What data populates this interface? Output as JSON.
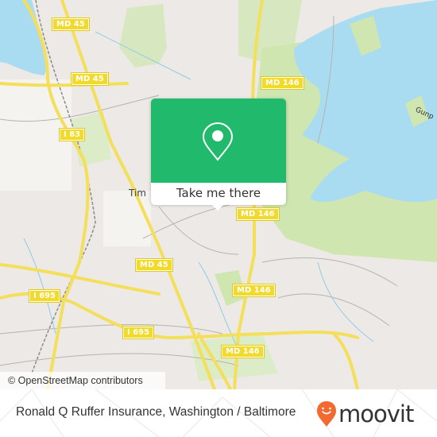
{
  "map": {
    "place_labels": [
      "Tim"
    ],
    "water_labels": [
      "Gunp"
    ],
    "road_shields": [
      {
        "id": "md45-top",
        "label": "MD 45"
      },
      {
        "id": "md45-mid",
        "label": "MD 45"
      },
      {
        "id": "i83",
        "label": "I 83"
      },
      {
        "id": "md146-north",
        "label": "MD 146"
      },
      {
        "id": "md146-center",
        "label": "MD 146"
      },
      {
        "id": "md45-south",
        "label": "MD 45"
      },
      {
        "id": "md146-east",
        "label": "MD 146"
      },
      {
        "id": "i695-west",
        "label": "I 695"
      },
      {
        "id": "i695-south",
        "label": "I 695"
      },
      {
        "id": "md146-south",
        "label": "MD 146"
      }
    ],
    "colors": {
      "land": "#ede9e6",
      "water": "#a9dcf0",
      "park": "#cfe6b0",
      "road_major": "#f3df5a",
      "brand_green": "#21b96b",
      "moovit_orange": "#f26a30"
    }
  },
  "popup": {
    "icon": "location-pin-icon",
    "button_label": "Take me there"
  },
  "attribution": "© OpenStreetMap contributors",
  "footer": {
    "title": "Ronald Q Ruffer Insurance, Washington / Baltimore",
    "logo_text": "moovit"
  }
}
